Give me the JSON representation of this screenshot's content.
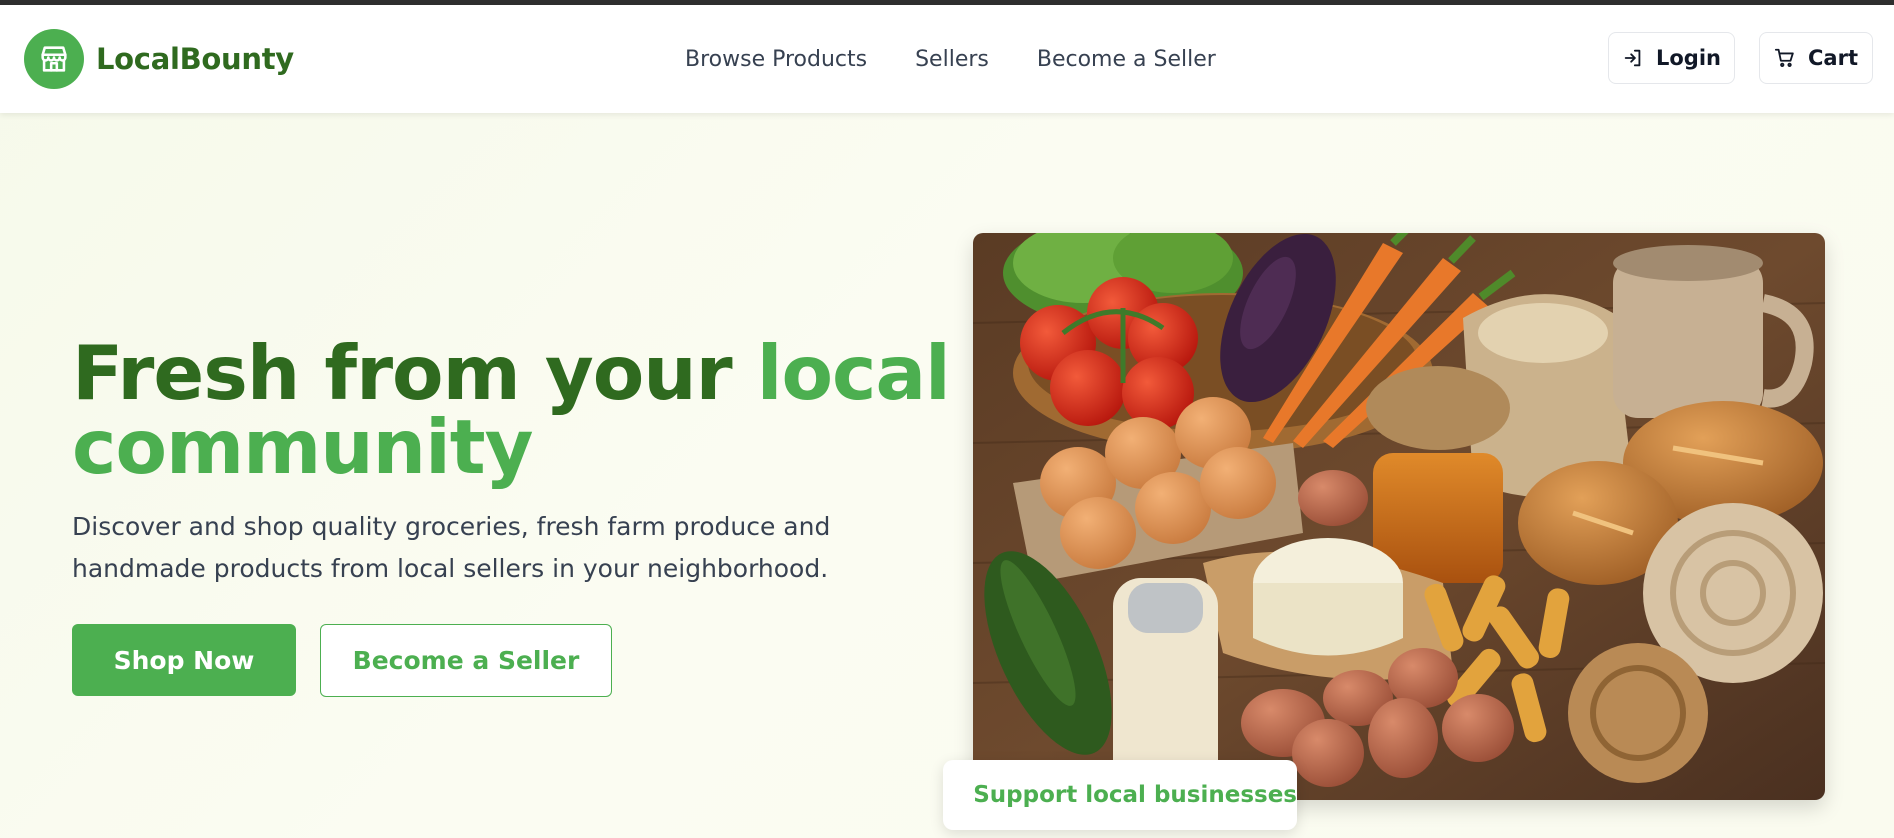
{
  "brand": {
    "name": "LocalBounty",
    "logo_icon": "storefront-icon"
  },
  "nav": {
    "items": [
      {
        "label": "Browse Products"
      },
      {
        "label": "Sellers"
      },
      {
        "label": "Become a Seller"
      }
    ]
  },
  "header_actions": {
    "login_label": "Login",
    "login_icon": "login-arrow-icon",
    "cart_label": "Cart",
    "cart_icon": "shopping-cart-icon"
  },
  "hero": {
    "title_main": "Fresh from your ",
    "title_accent_1": "local",
    "title_accent_2": "community",
    "subtitle": "Discover and shop quality groceries, fresh farm produce and handmade products from local sellers in your neighborhood.",
    "primary_button": "Shop Now",
    "secondary_button": "Become a Seller"
  },
  "badge": {
    "label": "Support local businesses",
    "icon": "thumbs-up-icon"
  },
  "colors": {
    "brand_green": "#4caf50",
    "brand_dark_green": "#2f6a1f",
    "hero_background": "#f7faec"
  }
}
